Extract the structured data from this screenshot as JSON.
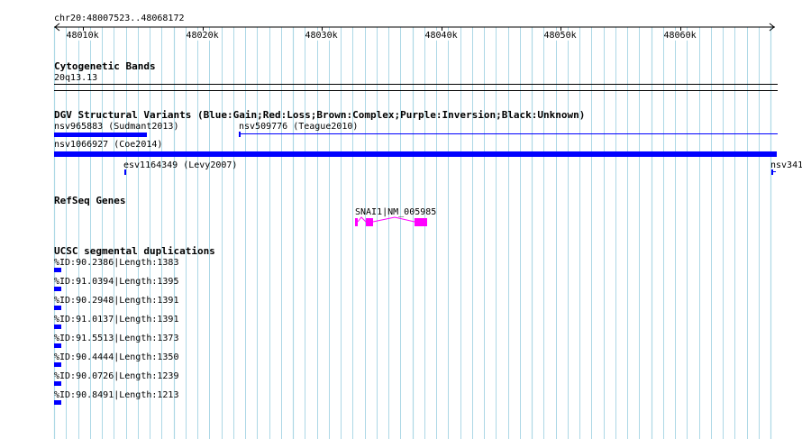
{
  "region": {
    "label": "chr20:48007523..48068172"
  },
  "ruler": {
    "ticks": [
      "48010k",
      "48020k",
      "48030k",
      "48040k",
      "48050k",
      "48060k"
    ]
  },
  "tracks": {
    "cytoband": {
      "title": "Cytogenetic Bands",
      "band_label": "20q13.13"
    },
    "dgv": {
      "title": "DGV Structural Variants (Blue:Gain;Red:Loss;Brown:Complex;Purple:Inversion;Black:Unknown)",
      "color": "#0000ff",
      "features": [
        {
          "label": "nsv965883 (Sudmant2013)"
        },
        {
          "label": "nsv509776 (Teague2010)"
        },
        {
          "label": "nsv1066927 (Coe2014)"
        },
        {
          "label": "esv1164349 (Levy2007)"
        },
        {
          "label": "nsv341"
        }
      ]
    },
    "refseq": {
      "title": "RefSeq Genes",
      "color": "#ff00ff",
      "gene": {
        "label": "SNAI1|NM_005985"
      }
    },
    "segdup": {
      "title": "UCSC segmental duplications",
      "color": "#0000ff",
      "items": [
        {
          "label": "%ID:90.2386|Length:1383"
        },
        {
          "label": "%ID:91.0394|Length:1395"
        },
        {
          "label": "%ID:90.2948|Length:1391"
        },
        {
          "label": "%ID:91.0137|Length:1391"
        },
        {
          "label": "%ID:91.5513|Length:1373"
        },
        {
          "label": "%ID:90.4444|Length:1350"
        },
        {
          "label": "%ID:90.0726|Length:1239"
        },
        {
          "label": "%ID:90.8491|Length:1213"
        }
      ]
    }
  },
  "colors": {
    "grid": "#add8e6",
    "rule": "#000000"
  }
}
